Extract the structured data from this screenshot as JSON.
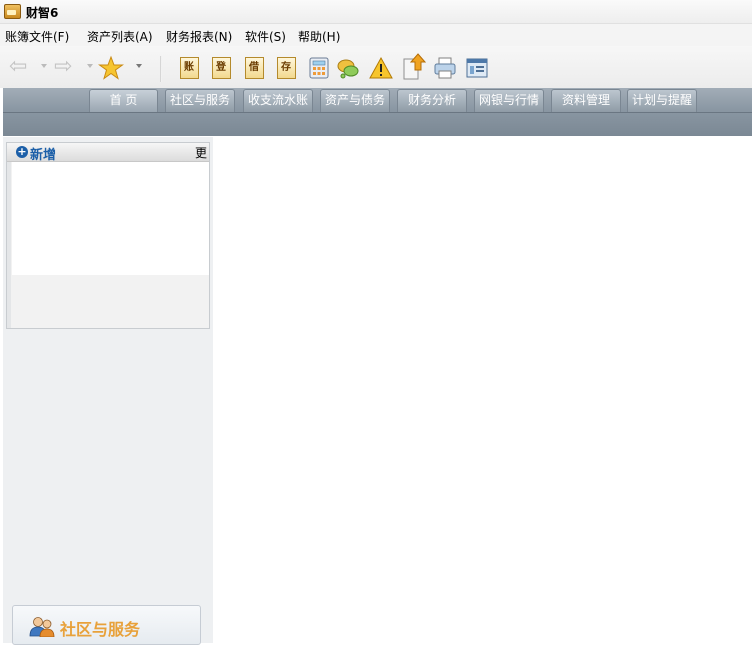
{
  "app": {
    "title": "财智6"
  },
  "menu": [
    {
      "label": "账簿文件(F)"
    },
    {
      "label": "资产列表(A)"
    },
    {
      "label": "财务报表(N)"
    },
    {
      "label": "软件(S)"
    },
    {
      "label": "帮助(H)"
    }
  ],
  "toolbar": {
    "icons": [
      {
        "name": "back-arrow-icon"
      },
      {
        "name": "forward-arrow-icon"
      },
      {
        "name": "favorites-star-icon"
      },
      {
        "name": "journal-icon",
        "glyph": "账"
      },
      {
        "name": "voucher-icon",
        "glyph": "登"
      },
      {
        "name": "budget-icon",
        "glyph": "借"
      },
      {
        "name": "deposit-icon",
        "glyph": "存"
      },
      {
        "name": "calculator-icon"
      },
      {
        "name": "chat-icon"
      },
      {
        "name": "warning-icon"
      },
      {
        "name": "upload-icon"
      },
      {
        "name": "print-icon"
      },
      {
        "name": "settings-icon"
      }
    ]
  },
  "tabs": [
    {
      "label": "首 页"
    },
    {
      "label": "社区与服务"
    },
    {
      "label": "收支流水账"
    },
    {
      "label": "资产与债务"
    },
    {
      "label": "财务分析"
    },
    {
      "label": "网银与行情"
    },
    {
      "label": "资料管理"
    },
    {
      "label": "计划与提醒"
    }
  ],
  "panel": {
    "add_label": "新增",
    "more_label": "更",
    "section_title": "社区与服务"
  },
  "colors": {
    "tab_band": "#8a97a3",
    "accent_blue": "#1c5fa8",
    "section_orange": "#e8a13a"
  }
}
